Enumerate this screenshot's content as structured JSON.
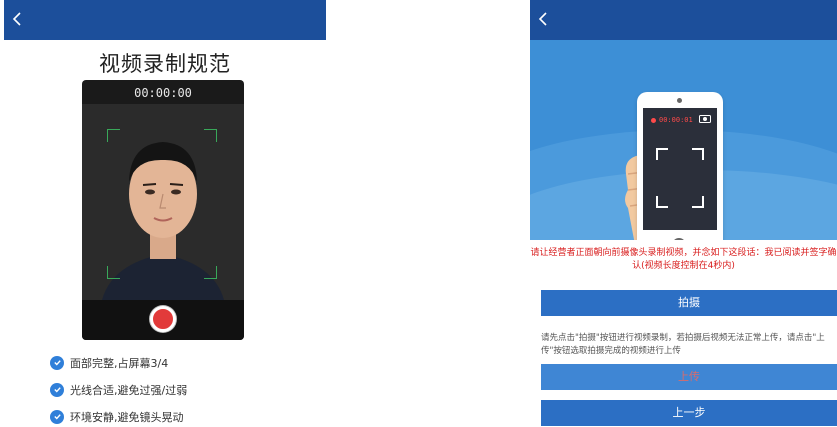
{
  "left_screen": {
    "title": "视频录制规范",
    "timer": "00:00:00",
    "checklist": [
      "面部完整,占屏幕3/4",
      "光线合适,避免过强/过弱",
      "环境安静,避免镜头晃动"
    ]
  },
  "right_screen": {
    "recording_timer": "00:00:01",
    "instruction": "请让经营者正面朝向前摄像头录制视频，并念如下这段话：我已阅读并签字确认(视频长度控制在4秒内)",
    "shoot_button": "拍摄",
    "help_text": "请先点击\"拍摄\"按钮进行视频录制，若拍摄后视频无法正常上传，请点击\"上传\"按钮选取拍摄完成的视频进行上传",
    "upload_button": "上传",
    "prev_button": "上一步"
  },
  "colors": {
    "header_blue": "#1c4f9b",
    "button_blue": "#2c6fc4",
    "warning_red": "#d92020",
    "check_blue": "#2f7fd9",
    "record_red": "#e23a3a"
  },
  "icons": [
    "back-arrow-icon",
    "check-circle-icon",
    "record-button-icon",
    "camera-icon",
    "record-dot-icon",
    "phone-in-hand-illustration"
  ]
}
